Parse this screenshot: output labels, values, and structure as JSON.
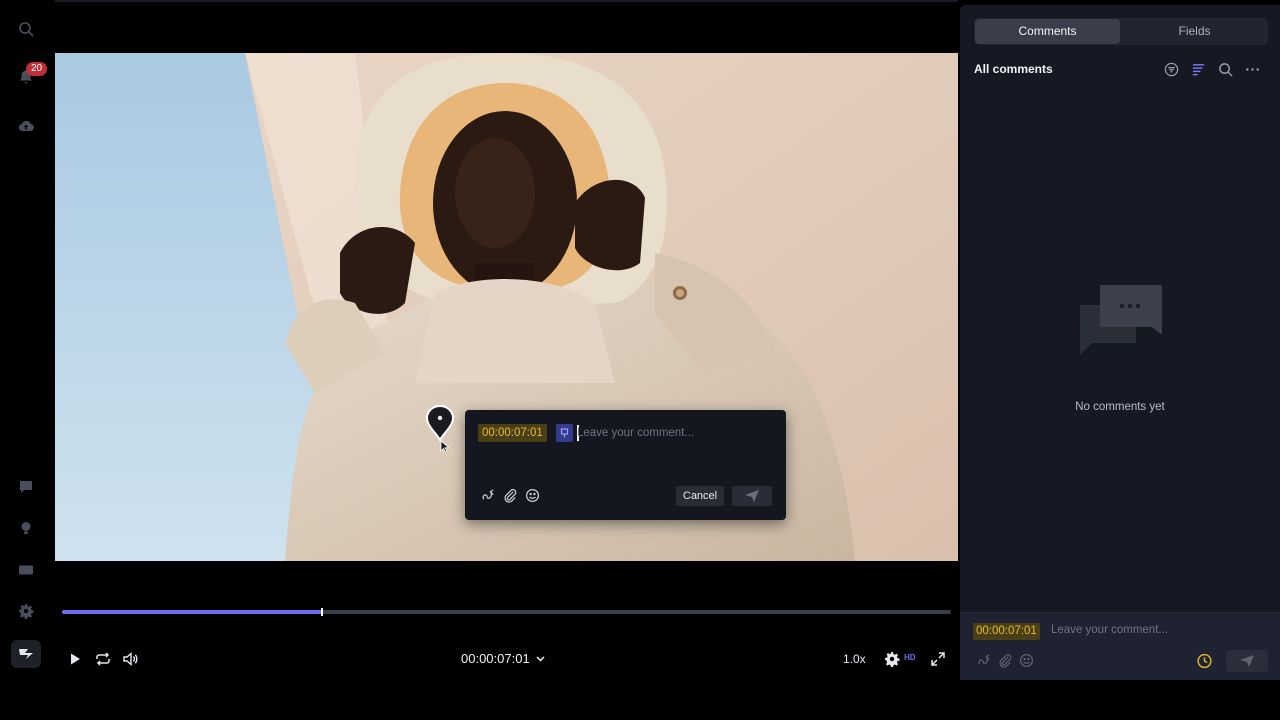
{
  "sidebar": {
    "notification_count": "20",
    "items": [
      {
        "name": "search-icon"
      },
      {
        "name": "bell-icon"
      },
      {
        "name": "cloud-upload-icon"
      },
      {
        "name": "help-icon"
      },
      {
        "name": "lightbulb-icon"
      },
      {
        "name": "keyboard-icon"
      },
      {
        "name": "gear-icon"
      },
      {
        "name": "logo-icon"
      }
    ]
  },
  "popover": {
    "timecode": "00:00:07:01",
    "placeholder": "Leave your comment...",
    "cancel_label": "Cancel",
    "tools": [
      "draw-icon",
      "attach-icon",
      "emoji-icon"
    ]
  },
  "player": {
    "timecode": "00:00:07:01",
    "speed": "1.0x",
    "quality": "HD",
    "progress_fraction": 0.293,
    "accent": "#6d6cf1"
  },
  "panel": {
    "tabs": [
      {
        "label": "Comments",
        "active": true
      },
      {
        "label": "Fields",
        "active": false
      }
    ],
    "heading": "All comments",
    "empty_text": "No comments yet",
    "composer": {
      "timecode": "00:00:07:01",
      "placeholder": "Leave your comment..."
    }
  },
  "colors": {
    "timecode_bg": "#4a3f15",
    "timecode_fg": "#e5b83a",
    "panel_bg": "#161924"
  }
}
